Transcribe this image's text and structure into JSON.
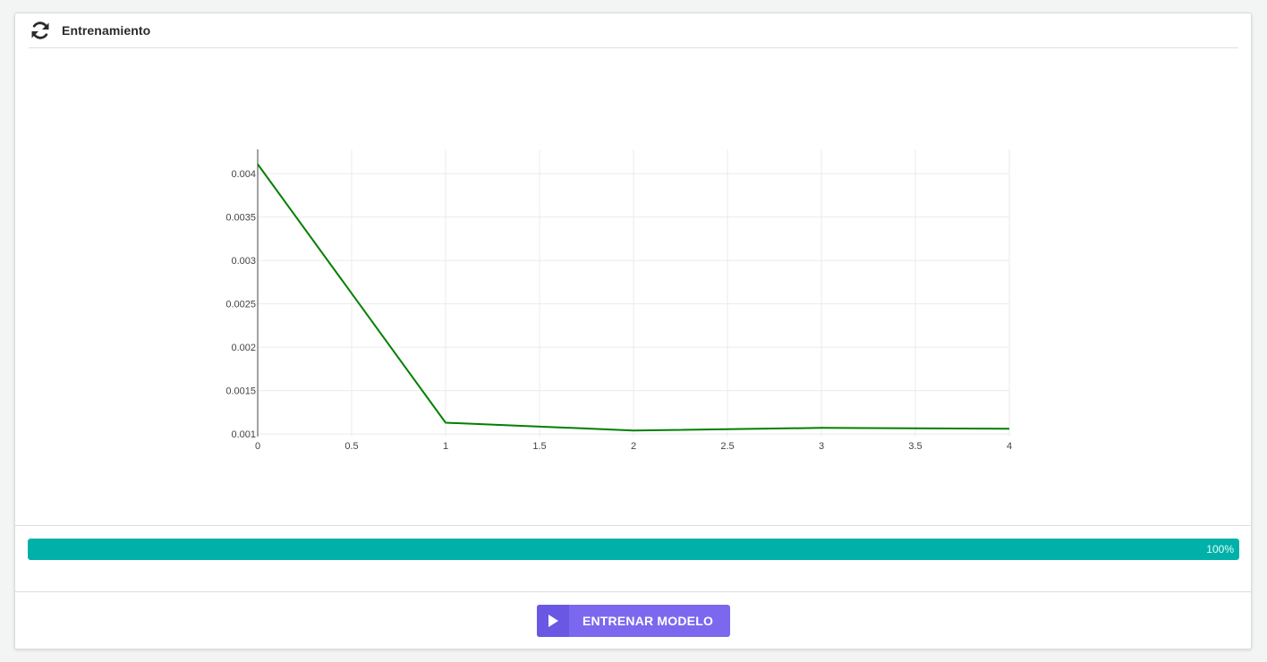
{
  "header": {
    "title": "Entrenamiento",
    "icon": "refresh-icon"
  },
  "chart_data": {
    "type": "line",
    "x": [
      0,
      1,
      2,
      3,
      4
    ],
    "series": [
      {
        "values": [
          0.00411,
          0.00113,
          0.00104,
          0.00107,
          0.00106
        ],
        "color": "#008000"
      }
    ],
    "xlim": [
      0,
      4
    ],
    "ylim": [
      0.00097,
      0.00428
    ],
    "xticks": [
      0,
      0.5,
      1,
      1.5,
      2,
      2.5,
      3,
      3.5,
      4
    ],
    "xtick_labels": [
      "0",
      "0.5",
      "1",
      "1.5",
      "2",
      "2.5",
      "3",
      "3.5",
      "4"
    ],
    "yticks": [
      0.001,
      0.0015,
      0.002,
      0.0025,
      0.003,
      0.0035,
      0.004
    ],
    "ytick_labels": [
      "0.001",
      "0.0015",
      "0.002",
      "0.0025",
      "0.003",
      "0.0035",
      "0.004"
    ],
    "grid": true,
    "title": "",
    "xlabel": "",
    "ylabel": ""
  },
  "progress": {
    "value": 100,
    "label": "100%",
    "color": "#00b1a9"
  },
  "train_button": {
    "label": "ENTRENAR MODELO",
    "icon": "play-icon",
    "color": "#7b68ee"
  }
}
